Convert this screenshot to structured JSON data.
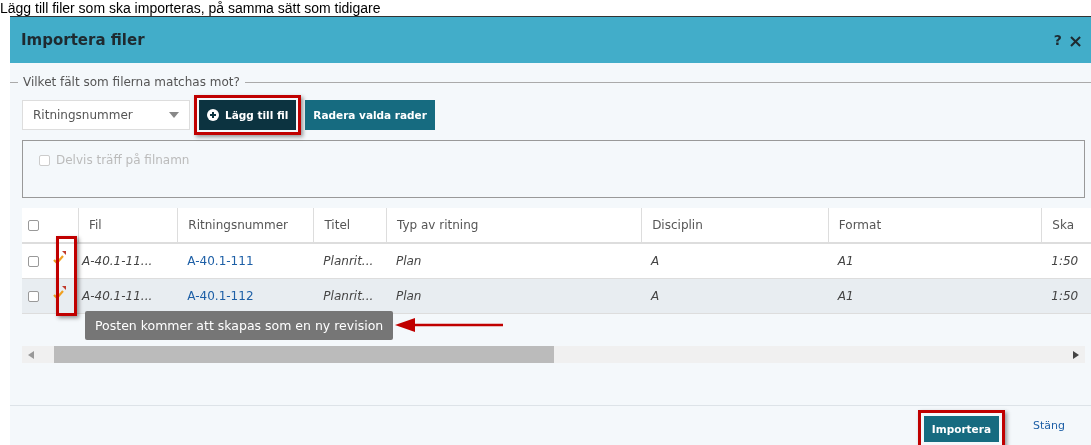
{
  "caption": "Lägg till filer som ska importeras, på samma sätt som tidigare",
  "window": {
    "title": "Importera filer",
    "help": "?",
    "close": "×"
  },
  "match": {
    "legend": "Vilket fält som filerna matchas mot?",
    "dropdown": "Ritningsnummer",
    "add_button": "Lägg till fil",
    "delete_button": "Radera valda rader"
  },
  "options": {
    "partial_match": {
      "label": "Delvis träff på filnamn",
      "checked": false,
      "disabled": true
    }
  },
  "table": {
    "select_all": {
      "checked": false
    },
    "columns": [
      "Fil",
      "Ritningsnummer",
      "Titel",
      "Typ av ritning",
      "Disciplin",
      "Format",
      "Ska"
    ],
    "rows": [
      {
        "checked": false,
        "highlighted": false,
        "cells": [
          "A-40.1-11...",
          "A-40.1-111",
          "Planrit...",
          "Plan",
          "A",
          "A1",
          "1:50"
        ]
      },
      {
        "checked": false,
        "highlighted": true,
        "cells": [
          "A-40.1-11...",
          "A-40.1-112",
          "Planrit...",
          "Plan",
          "A",
          "A1",
          "1:50"
        ]
      }
    ]
  },
  "tooltip": "Posten kommer att skapas som en ny revision",
  "footer": {
    "import_button": "Importera",
    "close_link": "Stäng"
  }
}
